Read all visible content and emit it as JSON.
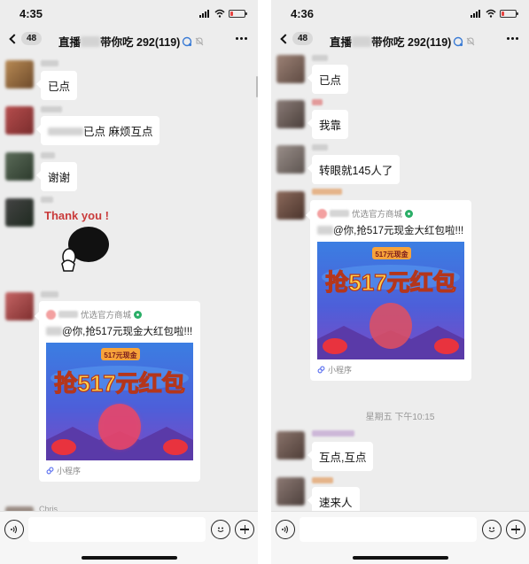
{
  "left": {
    "time": "4:35",
    "unread": "48",
    "title_suffix": "带你吃 292(119)",
    "title_prefix": "直播",
    "messages": [
      "已点",
      "已点 麻烦互点",
      "谢谢"
    ],
    "sticker_text": "Thank you !",
    "card": {
      "source": "优选官方商城",
      "text": "@你,抢517元现金大红包啦!!!",
      "banner_top": "517元现金",
      "banner_main": "抢517元红包",
      "footer": "小程序"
    },
    "partial_nick": "Chris"
  },
  "right": {
    "time": "4:36",
    "unread": "48",
    "title_prefix": "直播",
    "title_suffix": "带你吃 292(119)",
    "messages": [
      "已点",
      "我靠",
      "转眼就145人了"
    ],
    "card": {
      "source": "优选官方商城",
      "text": "@你,抢517元现金大红包啦!!!",
      "banner_top": "517元现金",
      "banner_main": "抢517元红包",
      "footer": "小程序"
    },
    "timestamp": "星期五 下午10:15",
    "messages_after": [
      "互点,互点",
      "速来人"
    ]
  },
  "colors": {
    "chat_bg": "#ededed",
    "bubble": "#ffffff",
    "sticker_red": "#c93b3b",
    "verified_green": "#2aae67",
    "battery_low": "#e64340"
  },
  "battery_level": 0.2,
  "icons": [
    "back-chevron-icon",
    "more-dots-icon",
    "voice-icon",
    "emoji-icon",
    "plus-icon",
    "mini-program-icon",
    "verified-icon"
  ]
}
